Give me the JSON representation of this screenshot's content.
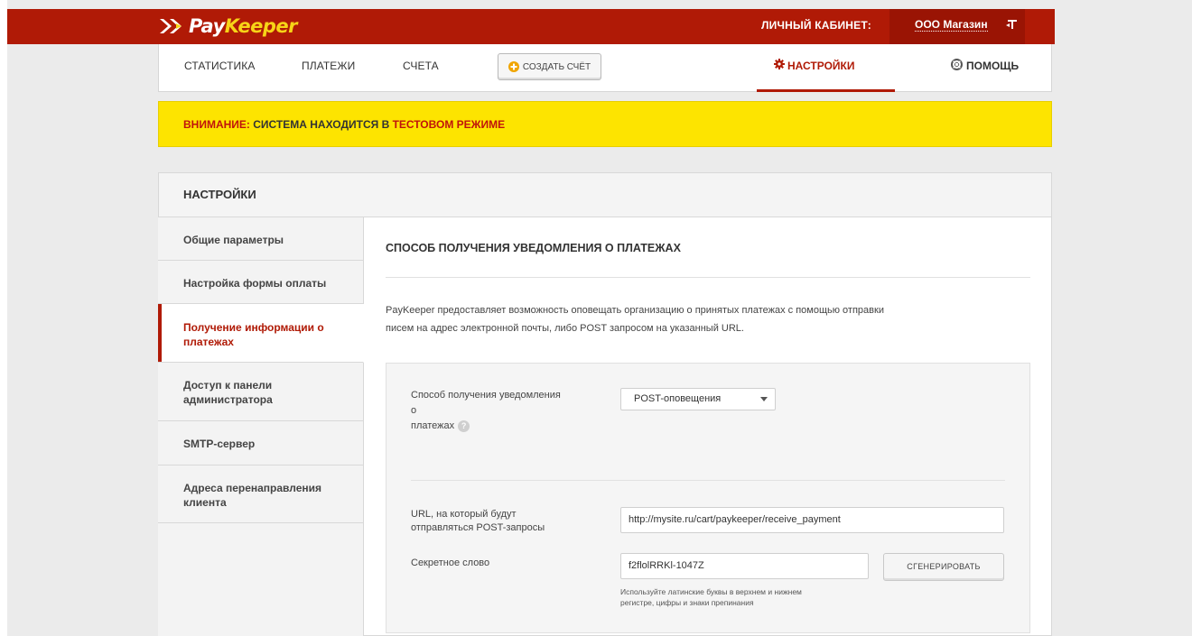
{
  "brand": {
    "pay": "Pay",
    "keeper": "Keeper"
  },
  "header": {
    "cabinet_label": "ЛИЧНЫЙ КАБИНЕТ:",
    "account_name": "ООО Магазин",
    "logout_icon": "logout-icon"
  },
  "nav": {
    "statistics": "СТАТИСТИКА",
    "payments": "ПЛАТЕЖИ",
    "invoices": "СЧЕТА",
    "create_invoice": "СОЗДАТЬ СЧЁТ",
    "settings": "НАСТРОЙКИ",
    "help": "ПОМОЩЬ"
  },
  "warning": {
    "prefix": "ВНИМАНИЕ:",
    "middle": " СИСТЕМА НАХОДИТСЯ В ",
    "mode": "ТЕСТОВОМ РЕЖИМЕ"
  },
  "panel": {
    "title": "НАСТРОЙКИ"
  },
  "sidebar": {
    "items": [
      {
        "label": "Общие параметры"
      },
      {
        "label": "Настройка формы оплаты"
      },
      {
        "label": "Получение информации о платежах",
        "active": true
      },
      {
        "label": "Доступ к панели администратора"
      },
      {
        "label": "SMTP-сервер"
      },
      {
        "label": "Адреса перенаправления клиента"
      }
    ]
  },
  "main": {
    "section_title": "СПОСОБ ПОЛУЧЕНИЯ УВЕДОМЛЕНИЯ О ПЛАТЕЖАХ",
    "description_line1": "PayKeeper предоставляет возможность оповещать организацию о принятых платежах с помощью отправки",
    "description_line2": "писем на адрес электронной почты, либо POST запросом на указанный URL.",
    "method_label_1": "Способ получения уведомления",
    "method_label_2": "о",
    "method_label_3": "платежах",
    "help_badge": "?",
    "method_value": "POST-оповещения",
    "url_label_1": "URL, на который будут",
    "url_label_2": "отправляться POST-запросы",
    "url_value": "http://mysite.ru/cart/paykeeper/receive_payment",
    "secret_label": "Секретное слово",
    "secret_value": "f2flolRRKl-1047Z",
    "generate_button": "СГЕНЕРИРОВАТЬ",
    "hint_line1": "Используйте латинские буквы в верхнем и нижнем",
    "hint_line2": "регистре, цифры и знаки препинания"
  },
  "colors": {
    "brand_red": "#b01a06",
    "brand_yellow": "#f7d417",
    "warning_bg": "#fde400"
  }
}
